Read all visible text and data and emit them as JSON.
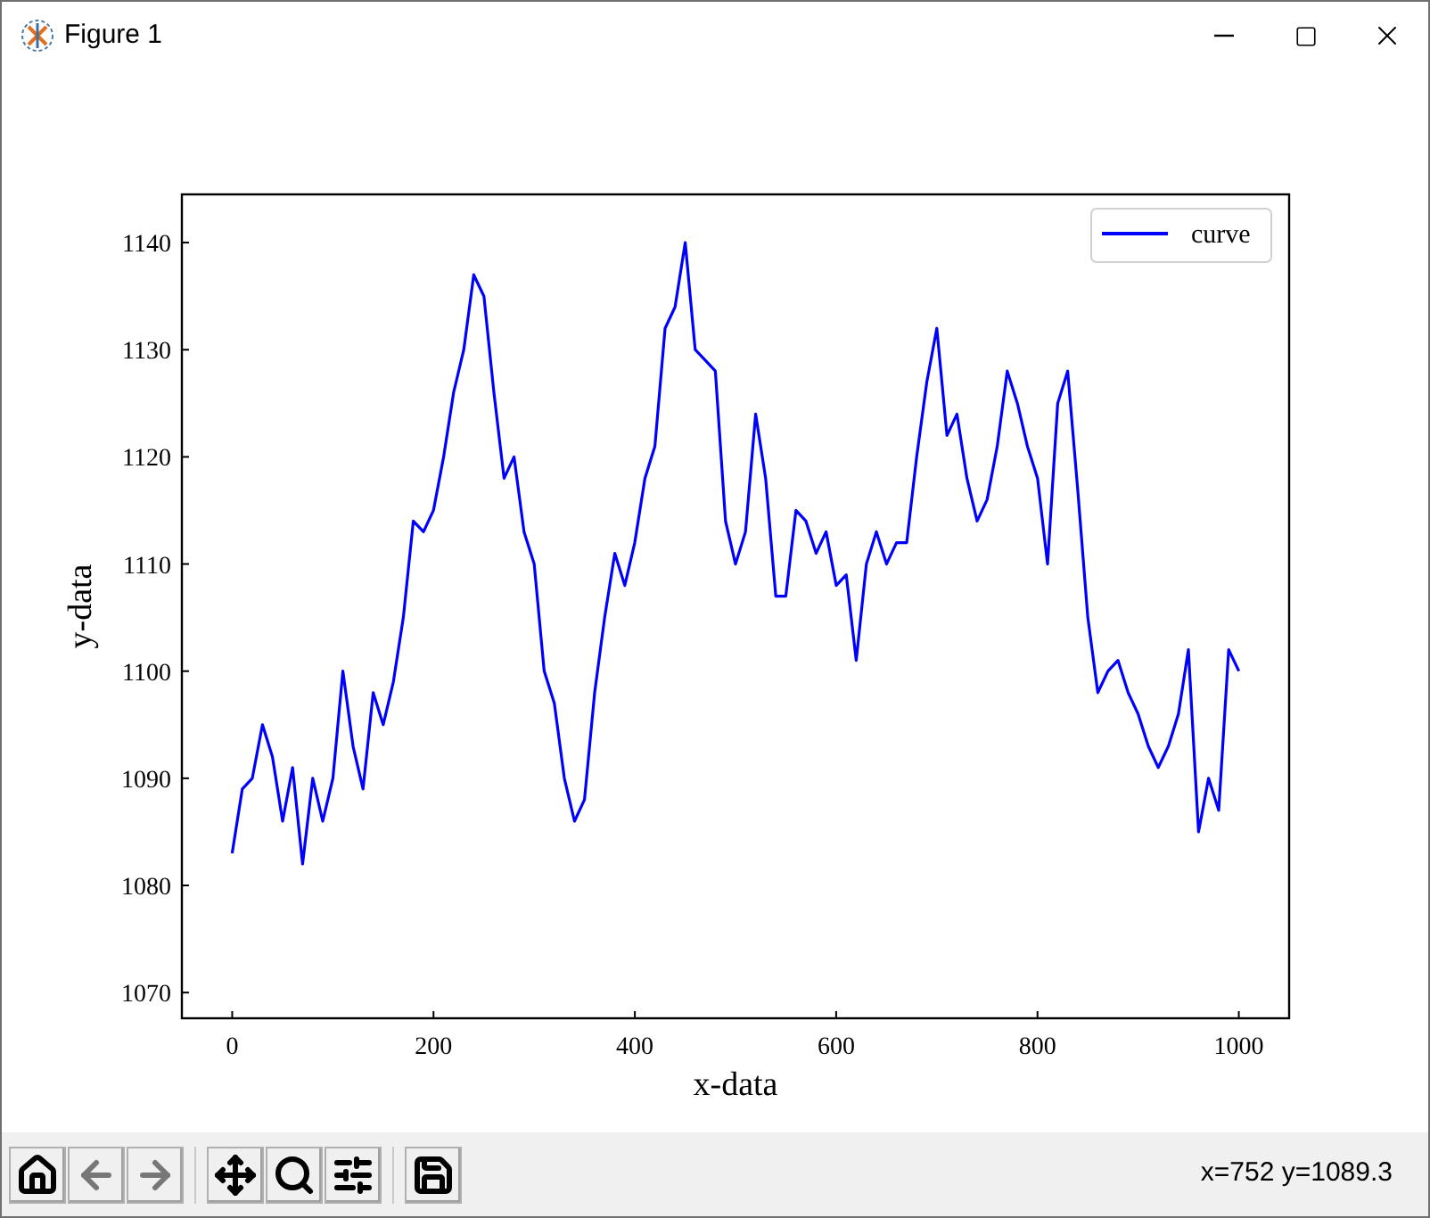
{
  "window": {
    "title": "Figure 1"
  },
  "figure": {
    "chart_data": {
      "type": "line",
      "xlabel": "x-data",
      "ylabel": "y-data",
      "xlim": [
        -50,
        1050
      ],
      "ylim": [
        1067.6,
        1144.5
      ],
      "xticks": [
        0,
        200,
        400,
        600,
        800,
        1000
      ],
      "yticks": [
        1070,
        1080,
        1090,
        1100,
        1110,
        1120,
        1130,
        1140
      ],
      "x": [
        0,
        10,
        20,
        30,
        40,
        50,
        60,
        70,
        80,
        90,
        100,
        110,
        120,
        130,
        140,
        150,
        160,
        170,
        180,
        190,
        200,
        210,
        220,
        230,
        240,
        250,
        260,
        270,
        280,
        290,
        300,
        310,
        320,
        330,
        340,
        350,
        360,
        370,
        380,
        390,
        400,
        410,
        420,
        430,
        440,
        450,
        460,
        470,
        480,
        490,
        500,
        510,
        520,
        530,
        540,
        550,
        560,
        570,
        580,
        590,
        600,
        610,
        620,
        630,
        640,
        650,
        660,
        670,
        680,
        690,
        700,
        710,
        720,
        730,
        740,
        750,
        760,
        770,
        780,
        790,
        800,
        810,
        820,
        830,
        840,
        850,
        860,
        870,
        880,
        890,
        900,
        910,
        920,
        930,
        940,
        950,
        960,
        970,
        980,
        990,
        1000
      ],
      "series": [
        {
          "name": "curve",
          "color": "#0000ff",
          "values": [
            1083,
            1089,
            1090,
            1095,
            1092,
            1086,
            1091,
            1082,
            1090,
            1086,
            1090,
            1100,
            1093,
            1089,
            1098,
            1095,
            1099,
            1105,
            1114,
            1113,
            1115,
            1120,
            1126,
            1130,
            1137,
            1135,
            1126,
            1118,
            1120,
            1113,
            1110,
            1100,
            1097,
            1090,
            1086,
            1088,
            1098,
            1105,
            1111,
            1108,
            1112,
            1118,
            1121,
            1132,
            1134,
            1140,
            1130,
            1129,
            1128,
            1114,
            1110,
            1113,
            1124,
            1118,
            1107,
            1107,
            1115,
            1114,
            1111,
            1113,
            1108,
            1109,
            1101,
            1110,
            1113,
            1110,
            1112,
            1112,
            1120,
            1127,
            1132,
            1122,
            1124,
            1118,
            1114,
            1116,
            1121,
            1128,
            1125,
            1121,
            1118,
            1110,
            1125,
            1128,
            1117,
            1105,
            1098,
            1100,
            1101,
            1098,
            1096,
            1093,
            1091,
            1093,
            1096,
            1102,
            1085,
            1090,
            1087,
            1102,
            1100
          ]
        }
      ]
    }
  },
  "toolbar": {
    "buttons": [
      {
        "kind": "home"
      },
      {
        "kind": "back"
      },
      {
        "kind": "forward"
      },
      {
        "kind": "pan"
      },
      {
        "kind": "zoom"
      },
      {
        "kind": "configure"
      },
      {
        "kind": "save"
      }
    ],
    "status": "x=752 y=1089.3"
  }
}
